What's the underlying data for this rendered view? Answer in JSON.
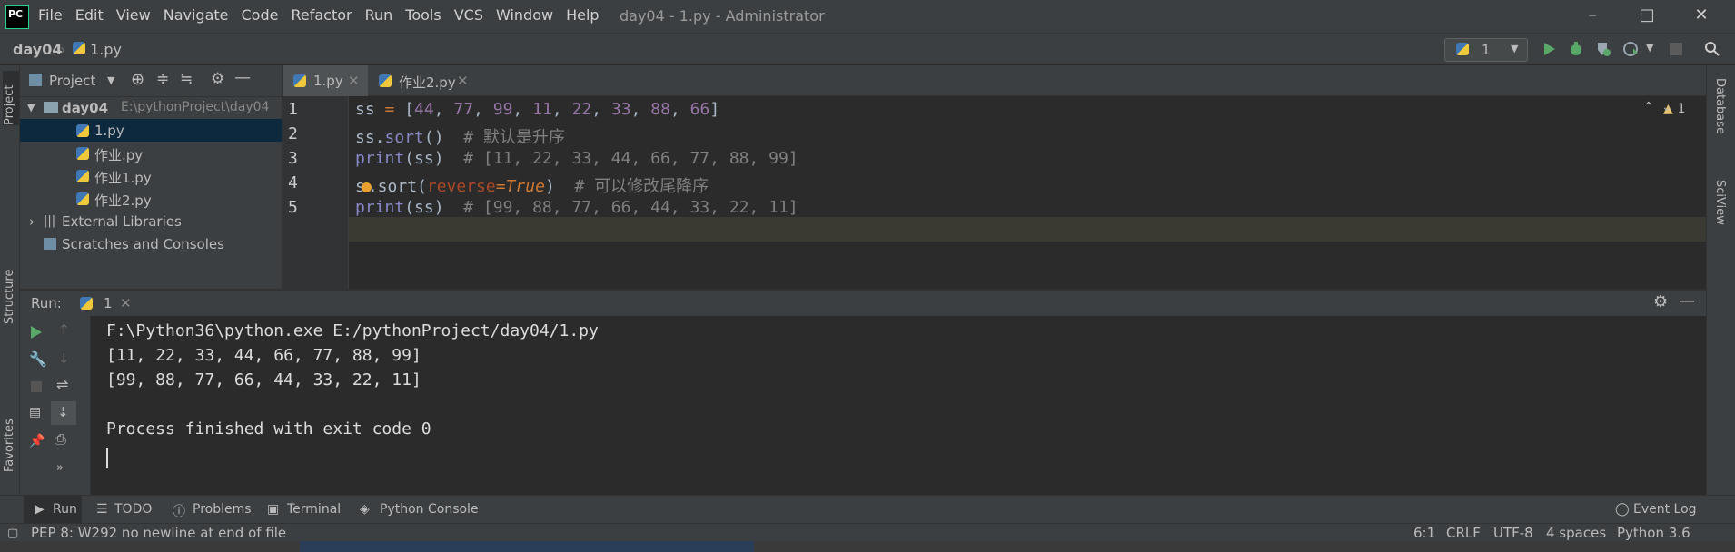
{
  "app": {
    "window_title": "day04 - 1.py - Administrator"
  },
  "menu": [
    "File",
    "Edit",
    "View",
    "Navigate",
    "Code",
    "Refactor",
    "Run",
    "Tools",
    "VCS",
    "Window",
    "Help"
  ],
  "nav": {
    "project": "day04",
    "file": "1.py",
    "run_config": "1"
  },
  "project_panel": {
    "title": "Project",
    "root": "day04",
    "root_path": "E:\\pythonProject\\day04",
    "files": [
      "1.py",
      "作业.py",
      "作业1.py",
      "作业2.py"
    ],
    "external": "External Libraries",
    "scratches": "Scratches and Consoles"
  },
  "left_stripe": {
    "project": "Project",
    "structure": "Structure",
    "favorites": "Favorites"
  },
  "right_stripe": {
    "database": "Database",
    "sciview": "SciView"
  },
  "tabs": [
    {
      "label": "1.py"
    },
    {
      "label": "作业2.py"
    }
  ],
  "editor": {
    "line_numbers": [
      "1",
      "2",
      "3",
      "4",
      "5"
    ],
    "warnings": "1",
    "code": {
      "l1": {
        "var": "ss",
        "eq": " = ",
        "open": "[",
        "n1": "44",
        "n2": "77",
        "n3": "99",
        "n4": "11",
        "n5": "22",
        "n6": "33",
        "n7": "88",
        "n8": "66",
        "close": "]",
        "sep": ", "
      },
      "l2": {
        "pre": "ss.",
        "fn": "sort",
        "post": "()",
        "comment": "  # 默认是升序"
      },
      "l3": {
        "fn": "print",
        "post": "(ss)",
        "comment": "  # [11, 22, 33, 44, 66, 77, 88, 99]"
      },
      "l4": {
        "pre": "s",
        "mid": ".sort(",
        "param": "reverse",
        "eq": "=",
        "kw": "True",
        "post": ")",
        "comment": "  # 可以修改尾降序"
      },
      "l5": {
        "fn": "print",
        "post": "(ss)",
        "comment": "  # [99, 88, 77, 66, 44, 33, 22, 11]"
      }
    }
  },
  "run": {
    "label": "Run:",
    "tab": "1",
    "console": [
      "F:\\Python36\\python.exe E:/pythonProject/day04/1.py",
      "[11, 22, 33, 44, 66, 77, 88, 99]",
      "[99, 88, 77, 66, 44, 33, 22, 11]",
      "",
      "Process finished with exit code 0"
    ]
  },
  "bottom_tabs": [
    "Run",
    "TODO",
    "Problems",
    "Terminal",
    "Python Console"
  ],
  "event_log": "Event Log",
  "status": {
    "message": "PEP 8: W292 no newline at end of file",
    "position": "6:1",
    "line_sep": "CRLF",
    "encoding": "UTF-8",
    "indent": "4 spaces",
    "interpreter": "Python 3.6"
  },
  "colors": {
    "accent": "#21d789",
    "run_green": "#59a869",
    "selection": "#0d293e"
  }
}
